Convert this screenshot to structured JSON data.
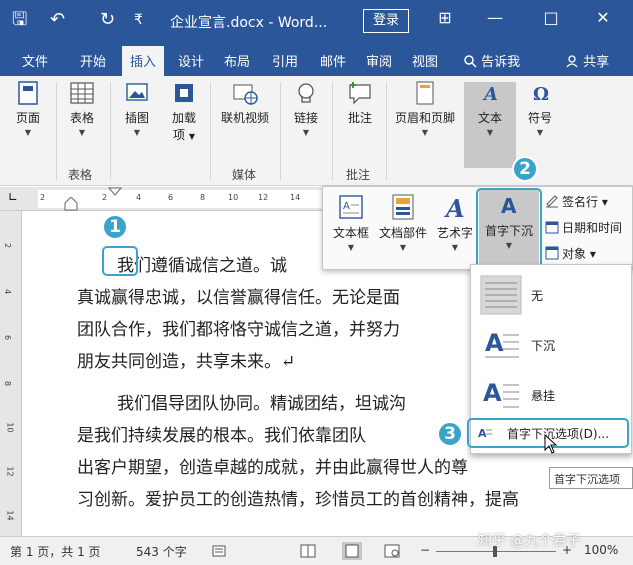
{
  "titlebar": {
    "title": "企业宣言.docx - Word...",
    "login": "登录",
    "save_icon": "🖫",
    "undo_icon": "↶",
    "redo_icon": "↻",
    "qa_more": "₹",
    "layout_icon": "⊞",
    "minimize": "—",
    "maximize": "□",
    "close": "✕"
  },
  "tabs": [
    "文件",
    "开始",
    "插入",
    "设计",
    "布局",
    "引用",
    "邮件",
    "审阅",
    "视图"
  ],
  "tell_me": "告诉我",
  "share": "共享",
  "ribbon": {
    "page": "页面",
    "table": "表格",
    "picture": "插图",
    "addin_1": "加载",
    "addin_2": "项",
    "online_video": "联机视频",
    "link": "链接",
    "comment": "批注",
    "header_footer": "页眉和页脚",
    "text": "文本",
    "symbol": "符号",
    "group_table": "表格",
    "group_media": "媒体",
    "group_comment": "批注"
  },
  "ruler": {
    "ticks": [
      "2",
      "2",
      "4",
      "6",
      "8",
      "10",
      "12",
      "14"
    ],
    "vticks": [
      "2",
      "4",
      "6",
      "8",
      "10",
      "12",
      "14"
    ]
  },
  "text_panel": {
    "textbox": "文本框",
    "quick_parts": "文档部件",
    "wordart": "艺术字",
    "dropcap": "首字下沉",
    "signature": "签名行",
    "datetime": "日期和时间",
    "object": "对象"
  },
  "dropdown": {
    "none": "无",
    "dropped": "下沉",
    "margin": "悬挂",
    "options": "首字下沉选项(D)..."
  },
  "tooltip": "首字下沉选项",
  "document": {
    "lines": [
      "我们遵循诚信之道。诚",
      "真诚赢得忠诚，以信誉赢得信任。无论是面",
      "团队合作，我们都将恪守诚信之道，并努力",
      "朋友共同创造，共享未来。↵",
      "我们倡导团队协同。精诚团结，坦诚沟",
      "是我们持续发展的根本。我们依靠团队",
      "出客户期望，创造卓越的成就，并由此赢得世人的尊",
      "习创新。爱护员工的创造热情，珍惜员工的首创精神，提高"
    ]
  },
  "callouts": [
    "1",
    "2",
    "3"
  ],
  "status": {
    "page": "第 1 页，共 1 页",
    "words": "543 个字",
    "zoom": "100%",
    "zoom_minus": "−",
    "zoom_plus": "+"
  },
  "watermark": "知乎 @九个君子",
  "colors": {
    "accent": "#2b579a",
    "callout": "#3aa3c9"
  }
}
